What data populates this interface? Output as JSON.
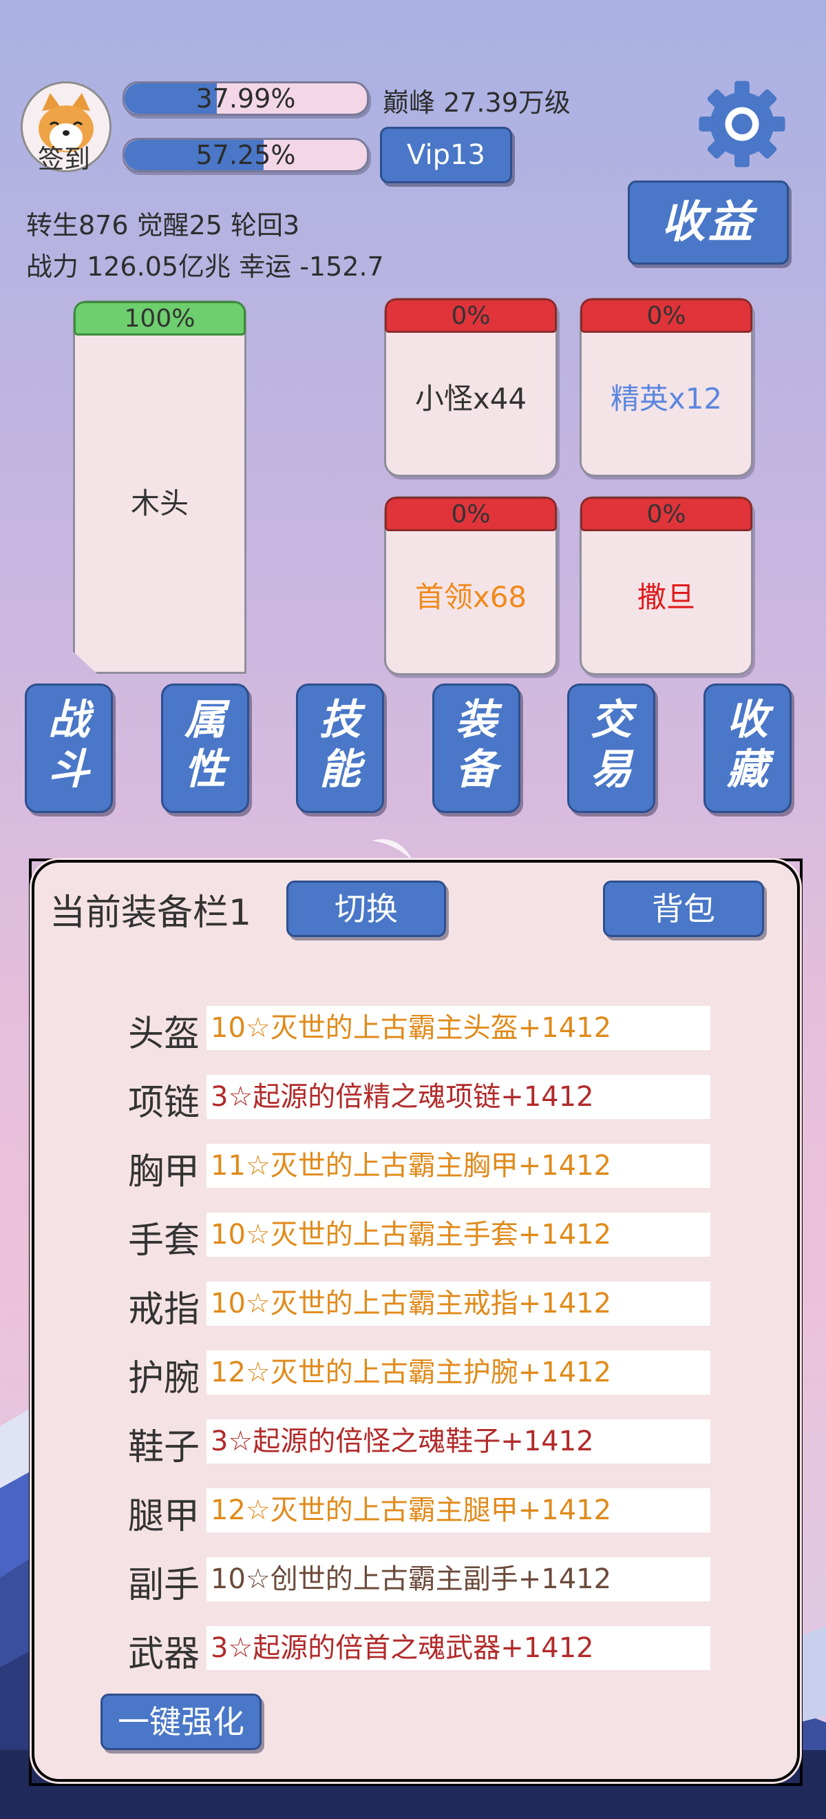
{
  "header": {
    "avatar_label": "签到",
    "bar1": {
      "progress": 0.3799,
      "text": "37.99%"
    },
    "bar2": {
      "progress": 0.5725,
      "text": "57.25%"
    },
    "peak_label": "巅峰 27.39万级",
    "vip_label": "Vip13",
    "stats_line1": "转生876 觉醒25 轮回3",
    "stats_line2": "战力 126.05亿兆  幸运 -152.7",
    "income_button": "收益",
    "settings_icon": "gear-icon"
  },
  "monsters": {
    "main": {
      "hp": "100%",
      "name": "木头",
      "hp_color": "#6dcf6d"
    },
    "cards": [
      {
        "hp": "0%",
        "name": "小怪x44",
        "color": "#333333"
      },
      {
        "hp": "0%",
        "name": "精英x12",
        "color": "#5b86e0"
      },
      {
        "hp": "0%",
        "name": "首领x68",
        "color": "#f08a1a"
      },
      {
        "hp": "0%",
        "name": "撒旦",
        "color": "#e01a1a"
      }
    ],
    "hp_bar_color": "#e0343a"
  },
  "nav": [
    {
      "line1": "战",
      "line2": "斗"
    },
    {
      "line1": "属",
      "line2": "性"
    },
    {
      "line1": "技",
      "line2": "能"
    },
    {
      "line1": "装",
      "line2": "备"
    },
    {
      "line1": "交",
      "line2": "易"
    },
    {
      "line1": "收",
      "line2": "藏"
    }
  ],
  "equipment": {
    "title": "当前装备栏1",
    "switch_button": "切换",
    "bag_button": "背包",
    "enhance_button": "一键强化",
    "slots": [
      {
        "label": "头盔",
        "value": "10☆灭世的上古霸主头盔+1412",
        "color": "#e08a1a"
      },
      {
        "label": "项链",
        "value": "3☆起源的倍精之魂项链+1412",
        "color": "#b22a2a"
      },
      {
        "label": "胸甲",
        "value": "11☆灭世的上古霸主胸甲+1412",
        "color": "#e08a1a"
      },
      {
        "label": "手套",
        "value": "10☆灭世的上古霸主手套+1412",
        "color": "#e08a1a"
      },
      {
        "label": "戒指",
        "value": "10☆灭世的上古霸主戒指+1412",
        "color": "#e08a1a"
      },
      {
        "label": "护腕",
        "value": "12☆灭世的上古霸主护腕+1412",
        "color": "#e08a1a"
      },
      {
        "label": "鞋子",
        "value": "3☆起源的倍怪之魂鞋子+1412",
        "color": "#b22a2a"
      },
      {
        "label": "腿甲",
        "value": "12☆灭世的上古霸主腿甲+1412",
        "color": "#e08a1a"
      },
      {
        "label": "副手",
        "value": "10☆创世的上古霸主副手+1412",
        "color": "#6b4a3a"
      },
      {
        "label": "武器",
        "value": "3☆起源的倍首之魂武器+1412",
        "color": "#b22a2a"
      }
    ]
  }
}
